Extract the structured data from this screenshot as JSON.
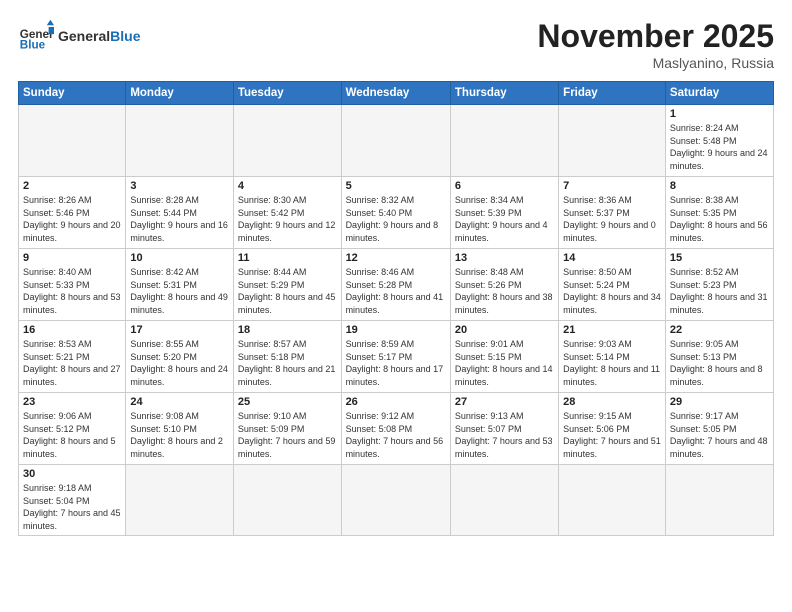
{
  "header": {
    "logo_general": "General",
    "logo_blue": "Blue",
    "month_title": "November 2025",
    "location": "Maslyanino, Russia"
  },
  "weekdays": [
    "Sunday",
    "Monday",
    "Tuesday",
    "Wednesday",
    "Thursday",
    "Friday",
    "Saturday"
  ],
  "weeks": [
    [
      {
        "day": "",
        "info": ""
      },
      {
        "day": "",
        "info": ""
      },
      {
        "day": "",
        "info": ""
      },
      {
        "day": "",
        "info": ""
      },
      {
        "day": "",
        "info": ""
      },
      {
        "day": "",
        "info": ""
      },
      {
        "day": "1",
        "info": "Sunrise: 8:24 AM\nSunset: 5:48 PM\nDaylight: 9 hours and 24 minutes."
      }
    ],
    [
      {
        "day": "2",
        "info": "Sunrise: 8:26 AM\nSunset: 5:46 PM\nDaylight: 9 hours and 20 minutes."
      },
      {
        "day": "3",
        "info": "Sunrise: 8:28 AM\nSunset: 5:44 PM\nDaylight: 9 hours and 16 minutes."
      },
      {
        "day": "4",
        "info": "Sunrise: 8:30 AM\nSunset: 5:42 PM\nDaylight: 9 hours and 12 minutes."
      },
      {
        "day": "5",
        "info": "Sunrise: 8:32 AM\nSunset: 5:40 PM\nDaylight: 9 hours and 8 minutes."
      },
      {
        "day": "6",
        "info": "Sunrise: 8:34 AM\nSunset: 5:39 PM\nDaylight: 9 hours and 4 minutes."
      },
      {
        "day": "7",
        "info": "Sunrise: 8:36 AM\nSunset: 5:37 PM\nDaylight: 9 hours and 0 minutes."
      },
      {
        "day": "8",
        "info": "Sunrise: 8:38 AM\nSunset: 5:35 PM\nDaylight: 8 hours and 56 minutes."
      }
    ],
    [
      {
        "day": "9",
        "info": "Sunrise: 8:40 AM\nSunset: 5:33 PM\nDaylight: 8 hours and 53 minutes."
      },
      {
        "day": "10",
        "info": "Sunrise: 8:42 AM\nSunset: 5:31 PM\nDaylight: 8 hours and 49 minutes."
      },
      {
        "day": "11",
        "info": "Sunrise: 8:44 AM\nSunset: 5:29 PM\nDaylight: 8 hours and 45 minutes."
      },
      {
        "day": "12",
        "info": "Sunrise: 8:46 AM\nSunset: 5:28 PM\nDaylight: 8 hours and 41 minutes."
      },
      {
        "day": "13",
        "info": "Sunrise: 8:48 AM\nSunset: 5:26 PM\nDaylight: 8 hours and 38 minutes."
      },
      {
        "day": "14",
        "info": "Sunrise: 8:50 AM\nSunset: 5:24 PM\nDaylight: 8 hours and 34 minutes."
      },
      {
        "day": "15",
        "info": "Sunrise: 8:52 AM\nSunset: 5:23 PM\nDaylight: 8 hours and 31 minutes."
      }
    ],
    [
      {
        "day": "16",
        "info": "Sunrise: 8:53 AM\nSunset: 5:21 PM\nDaylight: 8 hours and 27 minutes."
      },
      {
        "day": "17",
        "info": "Sunrise: 8:55 AM\nSunset: 5:20 PM\nDaylight: 8 hours and 24 minutes."
      },
      {
        "day": "18",
        "info": "Sunrise: 8:57 AM\nSunset: 5:18 PM\nDaylight: 8 hours and 21 minutes."
      },
      {
        "day": "19",
        "info": "Sunrise: 8:59 AM\nSunset: 5:17 PM\nDaylight: 8 hours and 17 minutes."
      },
      {
        "day": "20",
        "info": "Sunrise: 9:01 AM\nSunset: 5:15 PM\nDaylight: 8 hours and 14 minutes."
      },
      {
        "day": "21",
        "info": "Sunrise: 9:03 AM\nSunset: 5:14 PM\nDaylight: 8 hours and 11 minutes."
      },
      {
        "day": "22",
        "info": "Sunrise: 9:05 AM\nSunset: 5:13 PM\nDaylight: 8 hours and 8 minutes."
      }
    ],
    [
      {
        "day": "23",
        "info": "Sunrise: 9:06 AM\nSunset: 5:12 PM\nDaylight: 8 hours and 5 minutes."
      },
      {
        "day": "24",
        "info": "Sunrise: 9:08 AM\nSunset: 5:10 PM\nDaylight: 8 hours and 2 minutes."
      },
      {
        "day": "25",
        "info": "Sunrise: 9:10 AM\nSunset: 5:09 PM\nDaylight: 7 hours and 59 minutes."
      },
      {
        "day": "26",
        "info": "Sunrise: 9:12 AM\nSunset: 5:08 PM\nDaylight: 7 hours and 56 minutes."
      },
      {
        "day": "27",
        "info": "Sunrise: 9:13 AM\nSunset: 5:07 PM\nDaylight: 7 hours and 53 minutes."
      },
      {
        "day": "28",
        "info": "Sunrise: 9:15 AM\nSunset: 5:06 PM\nDaylight: 7 hours and 51 minutes."
      },
      {
        "day": "29",
        "info": "Sunrise: 9:17 AM\nSunset: 5:05 PM\nDaylight: 7 hours and 48 minutes."
      }
    ],
    [
      {
        "day": "30",
        "info": "Sunrise: 9:18 AM\nSunset: 5:04 PM\nDaylight: 7 hours and 45 minutes."
      },
      {
        "day": "",
        "info": ""
      },
      {
        "day": "",
        "info": ""
      },
      {
        "day": "",
        "info": ""
      },
      {
        "day": "",
        "info": ""
      },
      {
        "day": "",
        "info": ""
      },
      {
        "day": "",
        "info": ""
      }
    ]
  ]
}
